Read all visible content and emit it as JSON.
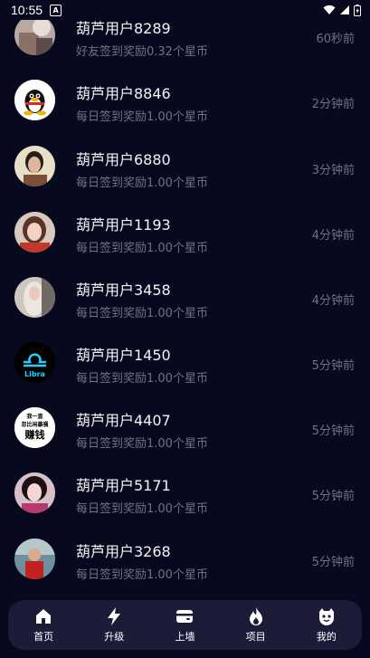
{
  "status_bar": {
    "time": "10:55",
    "notif_letter": "A"
  },
  "items": [
    {
      "name": "葫芦用户8289",
      "desc": "好友签到奖励0.32个星币",
      "time": "60秒前",
      "avatar": "photo"
    },
    {
      "name": "葫芦用户8846",
      "desc": "每日签到奖励1.00个星币",
      "time": "2分钟前",
      "avatar": "qq-penguin"
    },
    {
      "name": "葫芦用户6880",
      "desc": "每日签到奖励1.00个星币",
      "time": "3分钟前",
      "avatar": "photo"
    },
    {
      "name": "葫芦用户1193",
      "desc": "每日签到奖励1.00个星币",
      "time": "4分钟前",
      "avatar": "photo"
    },
    {
      "name": "葫芦用户3458",
      "desc": "每日签到奖励1.00个星币",
      "time": "4分钟前",
      "avatar": "photo"
    },
    {
      "name": "葫芦用户1450",
      "desc": "每日签到奖励1.00个星币",
      "time": "5分钟前",
      "avatar": "libra-logo",
      "avatar_text": "Libra"
    },
    {
      "name": "葫芦用户4407",
      "desc": "每日签到奖励1.00个星币",
      "time": "5分钟前",
      "avatar": "text-badge",
      "avatar_text": [
        "我一直",
        "忽比闲暴骚",
        "赚钱"
      ]
    },
    {
      "name": "葫芦用户5171",
      "desc": "每日签到奖励1.00个星币",
      "time": "5分钟前",
      "avatar": "photo"
    },
    {
      "name": "葫芦用户3268",
      "desc": "每日签到奖励1.00个星币",
      "time": "5分钟前",
      "avatar": "photo"
    }
  ],
  "tabbar": [
    {
      "label": "首页",
      "icon": "home-icon"
    },
    {
      "label": "升级",
      "icon": "lightning-icon"
    },
    {
      "label": "上墙",
      "icon": "wallet-icon"
    },
    {
      "label": "项目",
      "icon": "flame-icon"
    },
    {
      "label": "我的",
      "icon": "face-icon"
    }
  ],
  "colors": {
    "background": "#07091f",
    "tabbar": "#1b1d38",
    "muted_text": "#6f7184"
  }
}
